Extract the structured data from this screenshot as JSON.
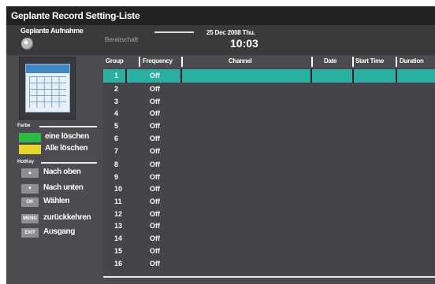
{
  "title": "Geplante Record Setting-Liste",
  "subtitle": "Geplante Aufnahme",
  "standby": "Bereitschaft",
  "date": "25 Dec 2008 Thu.",
  "time": "10:03",
  "sections": {
    "color": "Farbe",
    "hotkey": "HotKey"
  },
  "color_buttons": [
    {
      "color": "#2dbb48",
      "label": "eine löschen"
    },
    {
      "color": "#e8d62a",
      "label": "Alle löschen"
    }
  ],
  "hotkeys": [
    {
      "icon": "arrow-up-icon",
      "key": "▲",
      "label": "Nach oben"
    },
    {
      "icon": "arrow-down-icon",
      "key": "▼",
      "label": "Nach unten"
    },
    {
      "icon": "ok-key-icon",
      "key": "OK",
      "label": "Wählen"
    },
    {
      "icon": "menu-key-icon",
      "key": "MENU",
      "label": "zurückkehren"
    },
    {
      "icon": "exit-key-icon",
      "key": "EXIT",
      "label": "Ausgang"
    }
  ],
  "columns": [
    "Group",
    "Frequency",
    "Channel",
    "Date",
    "Start Time",
    "Duration"
  ],
  "rows": [
    {
      "group": "1",
      "frequency": "Off"
    },
    {
      "group": "2",
      "frequency": "Off"
    },
    {
      "group": "3",
      "frequency": "Off"
    },
    {
      "group": "4",
      "frequency": "Off"
    },
    {
      "group": "5",
      "frequency": "Off"
    },
    {
      "group": "6",
      "frequency": "Off"
    },
    {
      "group": "7",
      "frequency": "Off"
    },
    {
      "group": "8",
      "frequency": "Off"
    },
    {
      "group": "9",
      "frequency": "Off"
    },
    {
      "group": "10",
      "frequency": "Off"
    },
    {
      "group": "11",
      "frequency": "Off"
    },
    {
      "group": "12",
      "frequency": "Off"
    },
    {
      "group": "13",
      "frequency": "Off"
    },
    {
      "group": "14",
      "frequency": "Off"
    },
    {
      "group": "15",
      "frequency": "Off"
    },
    {
      "group": "16",
      "frequency": "Off"
    }
  ],
  "selected_row": 1,
  "colors": {
    "accent": "#29b0a0",
    "panel": "#4c4c50",
    "titlebar": "#222225"
  }
}
